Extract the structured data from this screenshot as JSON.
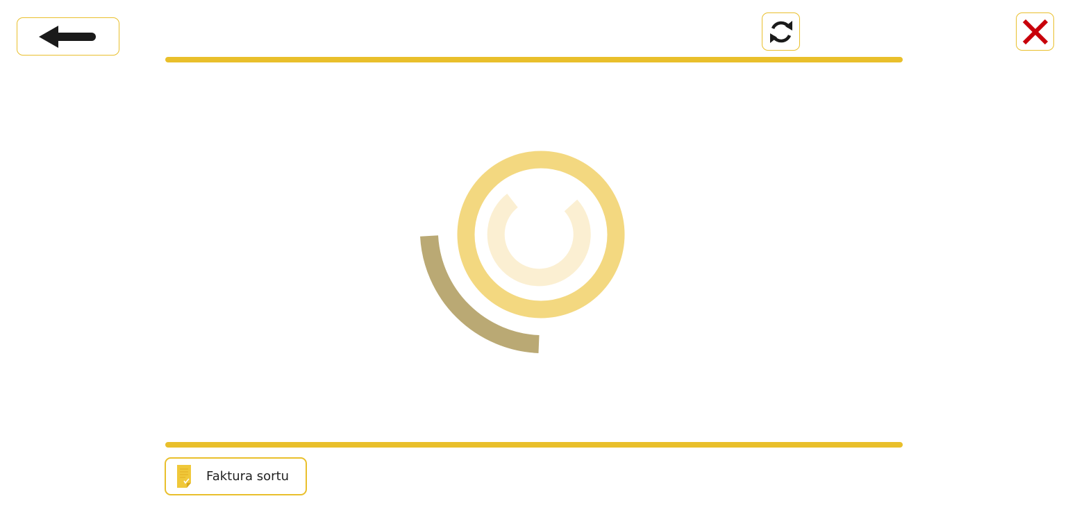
{
  "header": {
    "back_icon": "arrow-left-icon",
    "refresh_icon": "refresh-icon",
    "close_icon": "close-icon"
  },
  "loading": {
    "icon": "loading-spinner-icon"
  },
  "footer": {
    "invoice_button_label": "Faktura sortu",
    "invoice_icon": "document-icon"
  },
  "colors": {
    "accent": "#e9bf2b",
    "spinner_ring": "#f3d880",
    "spinner_inner": "#fbefd2",
    "spinner_arc": "#baa974",
    "close": "#c8000a",
    "icon_dark": "#1a1a1a"
  }
}
